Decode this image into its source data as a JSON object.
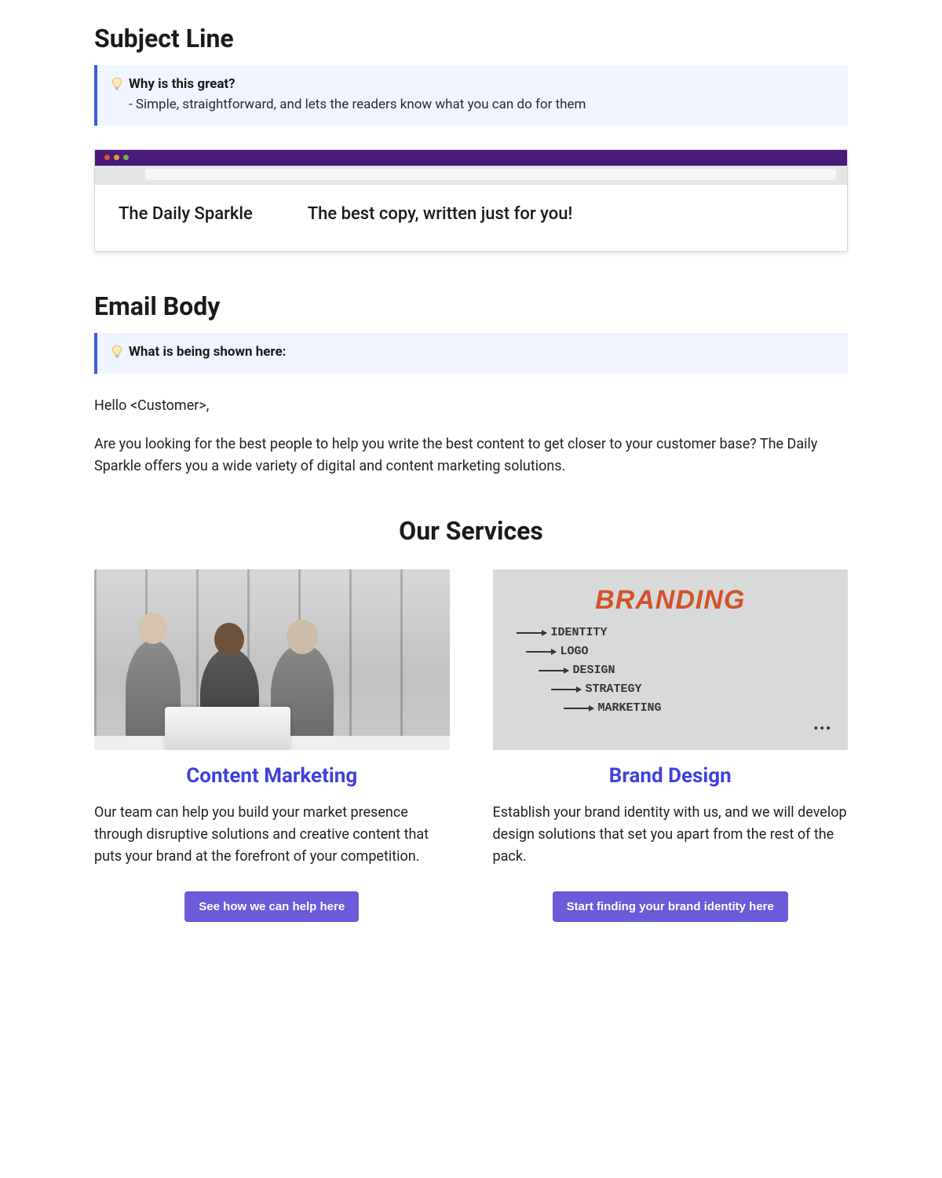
{
  "subject_line": {
    "heading": "Subject Line",
    "callout_title": "Why is this great?",
    "callout_body": "- Simple, straightforward, and lets the readers know what you can do for them"
  },
  "browser_preview": {
    "from": "The Daily Sparkle",
    "subject": "The best copy, written just for you!"
  },
  "email_body": {
    "heading": "Email Body",
    "callout_title": "What is being shown here:",
    "greeting": "Hello <Customer>,",
    "intro": "Are you looking for the best people to help you write the best content to get closer to your customer base? The Daily Sparkle offers you a wide variety of digital and content marketing solutions.",
    "services_heading": "Our Services",
    "services": [
      {
        "title": "Content Marketing",
        "desc": "Our team can help you build your market presence through disruptive solutions and creative content that puts your brand at the forefront of your competition.",
        "cta": "See how we can help here"
      },
      {
        "title": "Brand Design",
        "desc": "Establish your brand identity with us, and we will develop design solutions that set you apart from the rest of the pack.",
        "cta": "Start finding your brand identity here"
      }
    ],
    "brand_whiteboard": {
      "heading": "BRANDING",
      "items": [
        "IDENTITY",
        "LOGO",
        "DESIGN",
        "STRATEGY",
        "MARKETING"
      ],
      "ellipsis": "•••"
    }
  }
}
